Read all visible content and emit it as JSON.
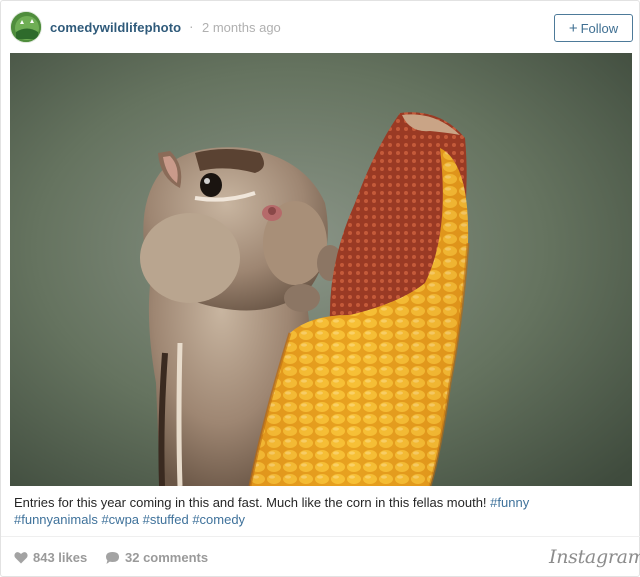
{
  "post": {
    "username": "comedywildlifephoto",
    "separator": "·",
    "timestamp": "2 months ago",
    "follow_label": "Follow",
    "follow_plus": "+",
    "avatar_icon": "comedy-wildlife-logo-icon",
    "avatar_logo_text": "comedy wildlife",
    "photo_alt": "chipmunk-eating-corn-photo"
  },
  "caption": {
    "text": "Entries for this year coming in this and fast. Much like the corn in this fellas mouth! ",
    "hashtags": [
      "#funny",
      "#funnyanimals",
      "#cwpa",
      "#stuffed",
      "#comedy"
    ]
  },
  "footer": {
    "likes": "843 likes",
    "comments": "32 comments",
    "like_icon": "heart-icon",
    "comment_icon": "speech-bubble-icon",
    "brand": "Instagram"
  },
  "colors": {
    "username": "#2f5a7a",
    "hashtag": "#3f729b",
    "follow_border": "#4d7a99",
    "meta_gray": "#9a9a9a"
  }
}
